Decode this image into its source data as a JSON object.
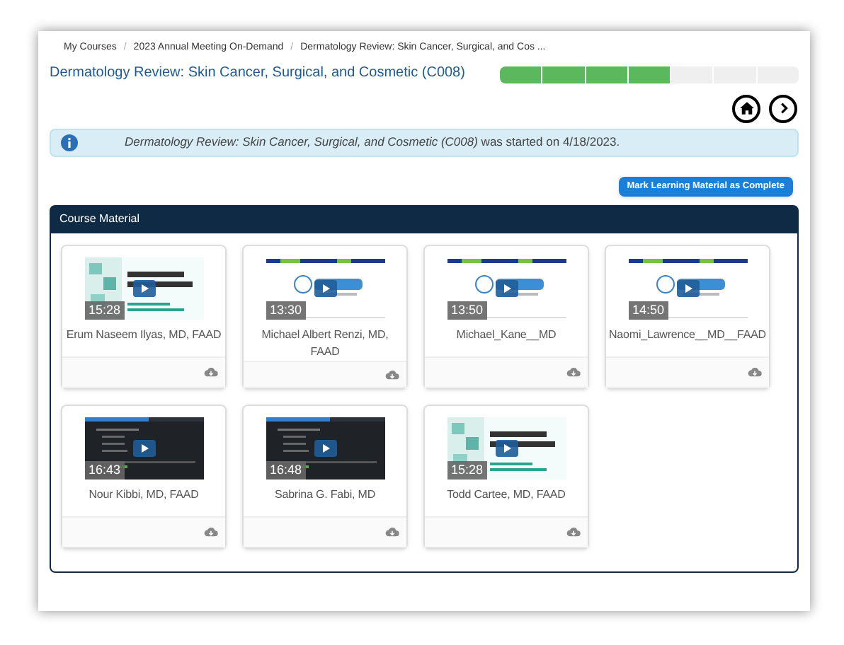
{
  "breadcrumb_separator": "/",
  "breadcrumb": [
    "My Courses",
    "2023 Annual Meeting On-Demand",
    "Dermatology Review: Skin Cancer, Surgical, and Cos ..."
  ],
  "title": "Dermatology Review: Skin Cancer, Surgical, and Cosmetic (C008)",
  "progress": [
    {
      "filled": true
    },
    {
      "filled": true
    },
    {
      "filled": true
    },
    {
      "filled": true
    },
    {
      "filled": false
    },
    {
      "filled": false
    },
    {
      "filled": false
    }
  ],
  "alert": "*Dermatology Review: Skin Cancer, Surgical, and Cosmetic (C008)* was started on 4/18/2023.",
  "complete_button": "Mark Learning Material as Complete",
  "panel": {
    "title": "Course Material",
    "videos": [
      {
        "duration": "15:28",
        "speaker": "Erum Naseem Ilyas, MD, FAAD"
      },
      {
        "duration": "13:30",
        "speaker": "Michael Albert Renzi, MD, FAAD"
      },
      {
        "duration": "13:50",
        "speaker": "Michael_Kane__MD"
      },
      {
        "duration": "14:50",
        "speaker": "Naomi_Lawrence__MD__FAAD"
      },
      {
        "duration": "16:43",
        "speaker": "Nour Kibbi, MD, FAAD"
      },
      {
        "duration": "16:48",
        "speaker": "Sabrina G. Fabi, MD"
      },
      {
        "duration": "15:28",
        "speaker": "Todd Cartee, MD, FAAD"
      }
    ]
  }
}
